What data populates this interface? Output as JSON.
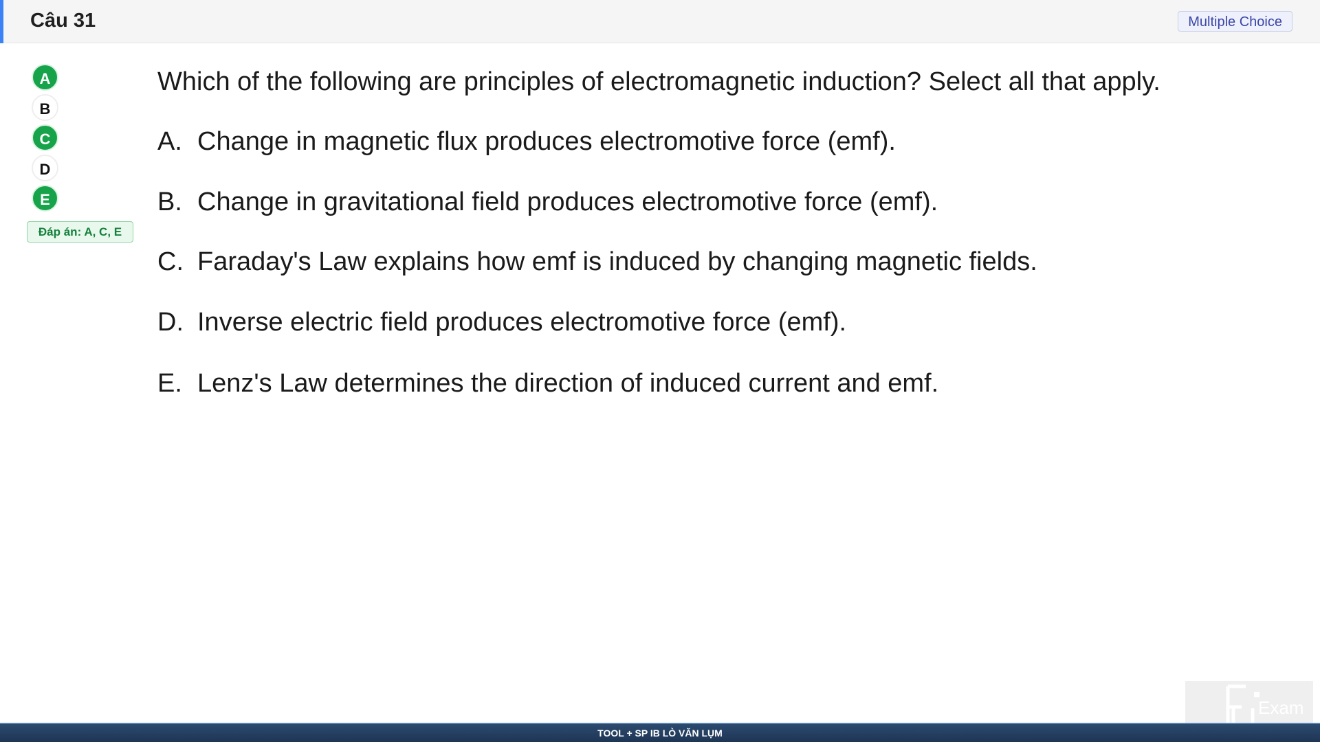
{
  "header": {
    "title": "Câu 31",
    "type_badge": "Multiple Choice",
    "accent_color": "#3b82f6"
  },
  "answer_sidebar": {
    "options": [
      {
        "letter": "A",
        "selected": true
      },
      {
        "letter": "B",
        "selected": false
      },
      {
        "letter": "C",
        "selected": true
      },
      {
        "letter": "D",
        "selected": false
      },
      {
        "letter": "E",
        "selected": true
      }
    ],
    "answer_key": "Đáp án: A, C, E",
    "selected_color": "#16a34a"
  },
  "question": {
    "text": "Which of the following are principles of electromagnetic induction? Select all that apply.",
    "choices": [
      {
        "letter": "A.",
        "text": "Change in magnetic flux produces electromotive force (emf)."
      },
      {
        "letter": "B.",
        "text": "Change in gravitational field produces electromotive force (emf)."
      },
      {
        "letter": "C.",
        "text": "Faraday's Law explains how emf is induced by changing magnetic fields."
      },
      {
        "letter": "D.",
        "text": "Inverse electric field produces electromotive force (emf)."
      },
      {
        "letter": "E.",
        "text": "Lenz's Law determines the direction of induced current and emf."
      }
    ]
  },
  "footer": {
    "text": "TOOL + SP IB LÒ VĂN LỤM"
  },
  "watermark": {
    "logo_text": "Exam"
  }
}
